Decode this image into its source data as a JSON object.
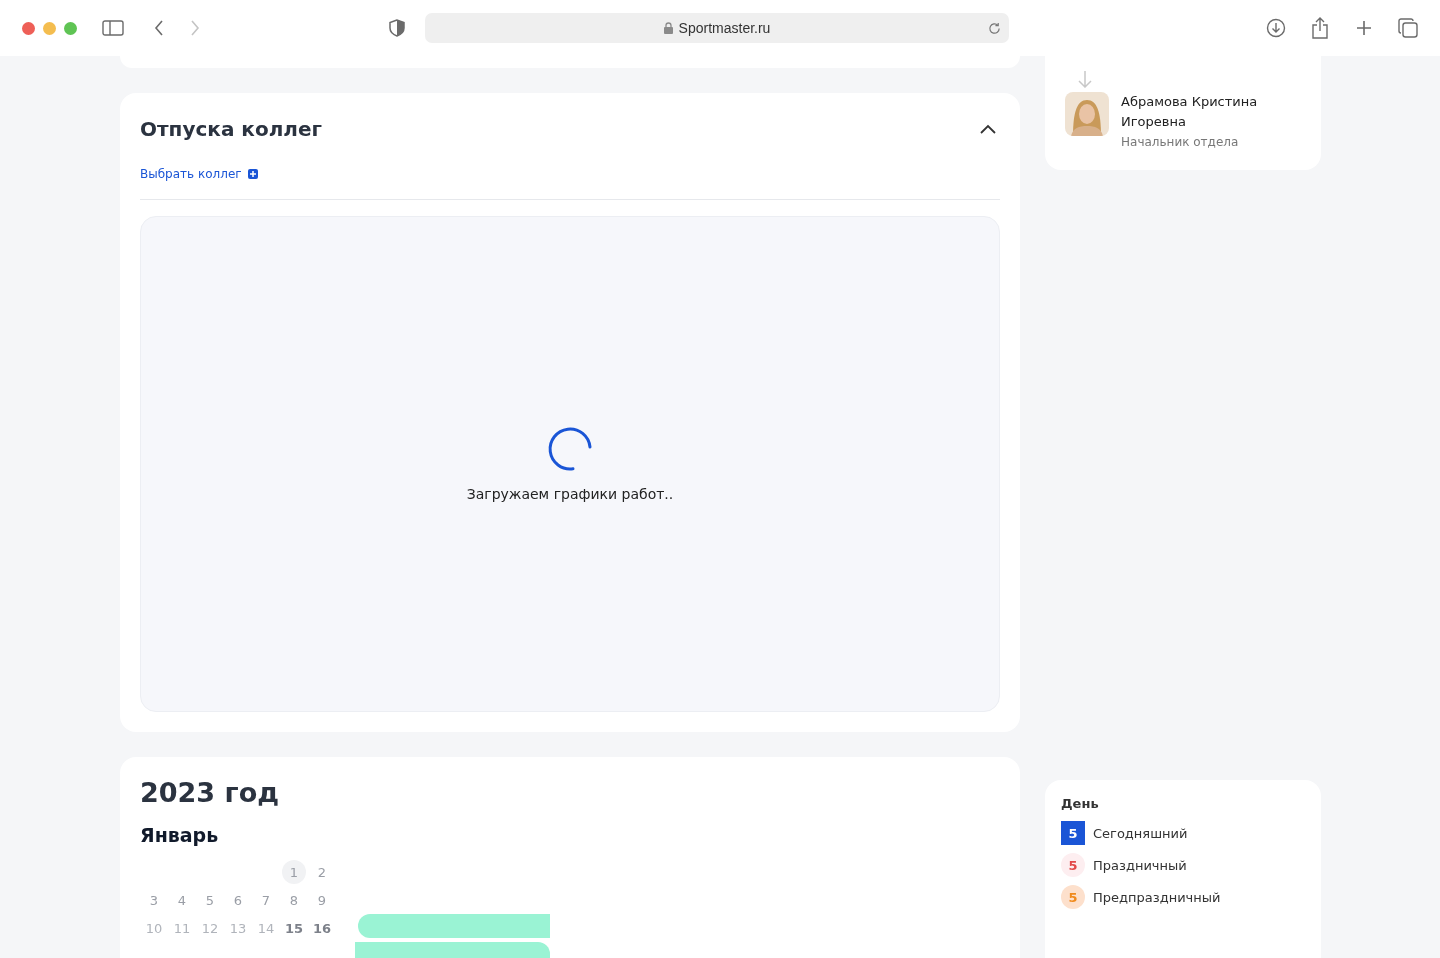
{
  "browser": {
    "url": "Sportmaster.ru",
    "forward_disabled": true
  },
  "vacations": {
    "title": "Отпуска коллег",
    "expanded": true,
    "add_link": "Выбрать коллег",
    "loading_text": "Загружаем графики работ.."
  },
  "calendar": {
    "year": "2023 год",
    "month": "Январь",
    "weeks": [
      [
        {
          "label": "1",
          "kind": "circled"
        },
        {
          "label": "2",
          "kind": "normal"
        }
      ],
      [
        {
          "label": "3",
          "kind": "normal"
        },
        {
          "label": "4",
          "kind": "normal"
        },
        {
          "label": "5",
          "kind": "normal"
        },
        {
          "label": "6",
          "kind": "normal"
        },
        {
          "label": "7",
          "kind": "normal"
        },
        {
          "label": "8",
          "kind": "normal"
        },
        {
          "label": "9",
          "kind": "normal"
        }
      ],
      [
        {
          "label": "10",
          "kind": "faded"
        },
        {
          "label": "11",
          "kind": "faded"
        },
        {
          "label": "12",
          "kind": "faded"
        },
        {
          "label": "13",
          "kind": "faded"
        },
        {
          "label": "14",
          "kind": "faded"
        },
        {
          "label": "15",
          "kind": "bold"
        },
        {
          "label": "16",
          "kind": "bold"
        }
      ]
    ]
  },
  "manager": {
    "name": "Абрамова Кристина Игоревна",
    "role": "Начальник отдела"
  },
  "legend": {
    "title": "День",
    "items": [
      {
        "number": "5",
        "label": "Сегодняшний",
        "kind": "today"
      },
      {
        "number": "5",
        "label": "Праздничный",
        "kind": "holiday"
      },
      {
        "number": "5",
        "label": "Предпраздничный",
        "kind": "preholiday"
      }
    ]
  }
}
